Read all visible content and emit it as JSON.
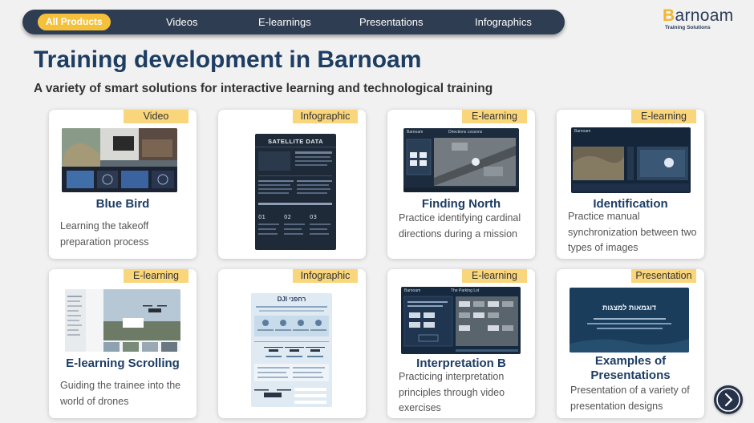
{
  "nav": {
    "items": [
      {
        "label": "All Products",
        "active": true
      },
      {
        "label": "Videos"
      },
      {
        "label": "E-learnings"
      },
      {
        "label": "Presentations"
      },
      {
        "label": "Infographics"
      }
    ]
  },
  "logo": {
    "name_first": "B",
    "name_rest": "arnoam",
    "tagline": "Training Solutions"
  },
  "header": {
    "title": "Training development in Barnoam",
    "subtitle": "A variety of smart solutions for interactive learning and technological training"
  },
  "cards": [
    {
      "tag": "Video",
      "title": "Blue Bird",
      "desc": "Learning the takeoff preparation process"
    },
    {
      "tag": "Infographic",
      "thumb": {
        "heading": "SATELLITE DATA"
      }
    },
    {
      "tag": "E-learning",
      "title": "Finding North",
      "desc": "Practice identifying cardinal directions during a mission",
      "thumb": {
        "app": "Barnoam",
        "header": "Directions Lessons"
      }
    },
    {
      "tag": "E-learning",
      "title": "Identification",
      "desc": "Practice manual synchronization between two types of images",
      "thumb": {
        "app": "Barnoam"
      }
    },
    {
      "tag": "E-learning",
      "title": "E-learning Scrolling",
      "desc": "Guiding the trainee into the world of drones"
    },
    {
      "tag": "Infographic",
      "thumb": {
        "heading": "DJI רחפני"
      }
    },
    {
      "tag": "E-learning",
      "title": "Interpretation B",
      "desc": "Practicing interpretation principles through video exercises",
      "thumb": {
        "app": "Barnoam",
        "header": "The Parking Lot",
        "button": "Continue"
      }
    },
    {
      "tag": "Presentation",
      "title": "Examples of Presentations",
      "desc": "Presentation of a variety of presentation designs",
      "thumb": {
        "heading": "דוגמאות למצגות"
      }
    }
  ],
  "colors": {
    "nav_bg": "#2f3d52",
    "accent": "#f6c13a",
    "tag_bg": "#f9d67c",
    "title": "#1e3d63"
  },
  "icons": {
    "next": "chevron-right-icon"
  }
}
